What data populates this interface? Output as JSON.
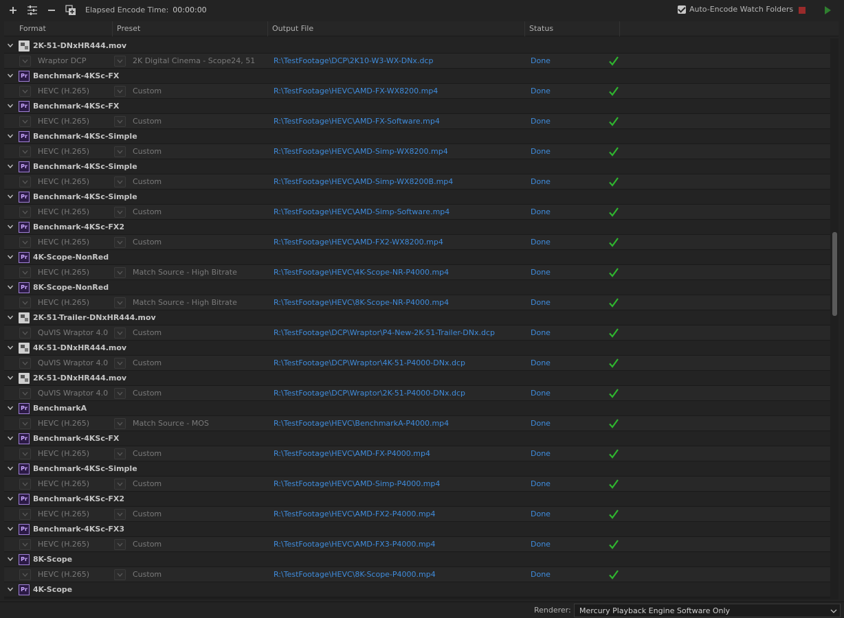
{
  "toolbar": {
    "elapsed_label": "Elapsed Encode Time:",
    "elapsed_value": "00:00:00",
    "auto_encode_label": "Auto-Encode Watch Folders",
    "auto_encode_checked": true
  },
  "columns": [
    "Format",
    "Preset",
    "Output File",
    "Status"
  ],
  "queue": [
    {
      "name": "2K-51-DNxHR444.mov",
      "icon": "mov",
      "format": "Wraptor DCP",
      "preset": "2K Digital Cinema - Scope24, 51",
      "output": "R:\\TestFootage\\DCP\\2K10-W3-WX-DNx.dcp",
      "status": "Done"
    },
    {
      "name": "Benchmark-4KSc-FX",
      "icon": "pr",
      "format": "HEVC (H.265)",
      "preset": "Custom",
      "output": "R:\\TestFootage\\HEVC\\AMD-FX-WX8200.mp4",
      "status": "Done"
    },
    {
      "name": "Benchmark-4KSc-FX",
      "icon": "pr",
      "format": "HEVC (H.265)",
      "preset": "Custom",
      "output": "R:\\TestFootage\\HEVC\\AMD-FX-Software.mp4",
      "status": "Done"
    },
    {
      "name": "Benchmark-4KSc-Simple",
      "icon": "pr",
      "format": "HEVC (H.265)",
      "preset": "Custom",
      "output": "R:\\TestFootage\\HEVC\\AMD-Simp-WX8200.mp4",
      "status": "Done"
    },
    {
      "name": "Benchmark-4KSc-Simple",
      "icon": "pr",
      "format": "HEVC (H.265)",
      "preset": "Custom",
      "output": "R:\\TestFootage\\HEVC\\AMD-Simp-WX8200B.mp4",
      "status": "Done"
    },
    {
      "name": "Benchmark-4KSc-Simple",
      "icon": "pr",
      "format": "HEVC (H.265)",
      "preset": "Custom",
      "output": "R:\\TestFootage\\HEVC\\AMD-Simp-Software.mp4",
      "status": "Done"
    },
    {
      "name": "Benchmark-4KSc-FX2",
      "icon": "pr",
      "format": "HEVC (H.265)",
      "preset": "Custom",
      "output": "R:\\TestFootage\\HEVC\\AMD-FX2-WX8200.mp4",
      "status": "Done"
    },
    {
      "name": "4K-Scope-NonRed",
      "icon": "pr",
      "format": "HEVC (H.265)",
      "preset": "Match Source - High Bitrate",
      "output": "R:\\TestFootage\\HEVC\\4K-Scope-NR-P4000.mp4",
      "status": "Done"
    },
    {
      "name": "8K-Scope-NonRed",
      "icon": "pr",
      "format": "HEVC (H.265)",
      "preset": "Match Source - High Bitrate",
      "output": "R:\\TestFootage\\HEVC\\8K-Scope-NR-P4000.mp4",
      "status": "Done"
    },
    {
      "name": "2K-51-Trailer-DNxHR444.mov",
      "icon": "mov",
      "format": "QuVIS Wraptor 4.0",
      "preset": "Custom",
      "output": "R:\\TestFootage\\DCP\\Wraptor\\P4-New-2K-51-Trailer-DNx.dcp",
      "status": "Done"
    },
    {
      "name": "4K-51-DNxHR444.mov",
      "icon": "mov",
      "format": "QuVIS Wraptor 4.0",
      "preset": "Custom",
      "output": "R:\\TestFootage\\DCP\\Wraptor\\4K-51-P4000-DNx.dcp",
      "status": "Done"
    },
    {
      "name": "2K-51-DNxHR444.mov",
      "icon": "mov",
      "format": "QuVIS Wraptor 4.0",
      "preset": "Custom",
      "output": "R:\\TestFootage\\DCP\\Wraptor\\2K-51-P4000-DNx.dcp",
      "status": "Done"
    },
    {
      "name": "BenchmarkA",
      "icon": "pr",
      "format": "HEVC (H.265)",
      "preset": "Match Source - MOS",
      "output": "R:\\TestFootage\\HEVC\\BenchmarkA-P4000.mp4",
      "status": "Done"
    },
    {
      "name": "Benchmark-4KSc-FX",
      "icon": "pr",
      "format": "HEVC (H.265)",
      "preset": "Custom",
      "output": "R:\\TestFootage\\HEVC\\AMD-FX-P4000.mp4",
      "status": "Done"
    },
    {
      "name": "Benchmark-4KSc-Simple",
      "icon": "pr",
      "format": "HEVC (H.265)",
      "preset": "Custom",
      "output": "R:\\TestFootage\\HEVC\\AMD-Simp-P4000.mp4",
      "status": "Done"
    },
    {
      "name": "Benchmark-4KSc-FX2",
      "icon": "pr",
      "format": "HEVC (H.265)",
      "preset": "Custom",
      "output": "R:\\TestFootage\\HEVC\\AMD-FX2-P4000.mp4",
      "status": "Done"
    },
    {
      "name": "Benchmark-4KSc-FX3",
      "icon": "pr",
      "format": "HEVC (H.265)",
      "preset": "Custom",
      "output": "R:\\TestFootage\\HEVC\\AMD-FX3-P4000.mp4",
      "status": "Done"
    },
    {
      "name": "8K-Scope",
      "icon": "pr",
      "format": "HEVC (H.265)",
      "preset": "Custom",
      "output": "R:\\TestFootage\\HEVC\\8K-Scope-P4000.mp4",
      "status": "Done"
    },
    {
      "name": "4K-Scope",
      "icon": "pr",
      "format": "",
      "preset": "",
      "output": "",
      "status": ""
    }
  ],
  "pr_icon_text": "Pr",
  "renderer": {
    "label": "Renderer:",
    "value": "Mercury Playback Engine Software Only"
  },
  "colors": {
    "background": "#232323",
    "link": "#3f8cdc",
    "done_check": "#2fb52f",
    "stop": "#9a2b2b",
    "start": "#2f7f2f"
  }
}
